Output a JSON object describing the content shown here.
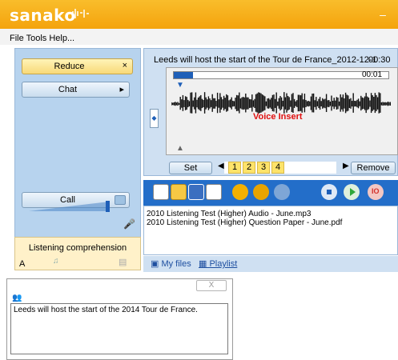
{
  "app": {
    "logo_text": "sanako",
    "minimize_glyph": "–"
  },
  "menu": {
    "text": "File Tools Help..."
  },
  "left": {
    "reduce_label": "Reduce",
    "reduce_close": "×",
    "chat_label": "Chat",
    "chat_arrow": "▸",
    "call_label": "Call",
    "volume_level": 0.9,
    "listening_title": "Listening comprehension",
    "listening_letter": "A"
  },
  "player": {
    "track_title": "Leeds will host the start of the Tour de France_2012-12-1",
    "track_duration": "00:30",
    "position_time": "00:01",
    "progress": 0.03,
    "voice_insert_label": "Voice Insert",
    "set_label": "Set",
    "numbers": [
      "1",
      "2",
      "3",
      "4"
    ],
    "remove_label": "Remove"
  },
  "toolbar": {
    "icons": [
      "new-file-icon",
      "open-folder-icon",
      "save-icon",
      "audio-wave-icon",
      "swap-icon",
      "repeat-icon",
      "forward-icon",
      "stop-icon",
      "play-icon",
      "record-icon"
    ],
    "colors": {
      "accent": "#236ec9",
      "orange": "#f4a30d",
      "stop": "#1e5fb8",
      "play": "#2fa83a",
      "record": "#d2302a"
    }
  },
  "files": {
    "items": [
      "2010 Listening Test (Higher) Audio - June.mp3",
      "2010 Listening Test (Higher) Question Paper - June.pdf"
    ],
    "tab_myfiles": "My files",
    "tab_playlist": "Playlist"
  },
  "chat": {
    "close_glyph": "X",
    "message": "Leeds will host the start of the 2014 Tour de France."
  }
}
